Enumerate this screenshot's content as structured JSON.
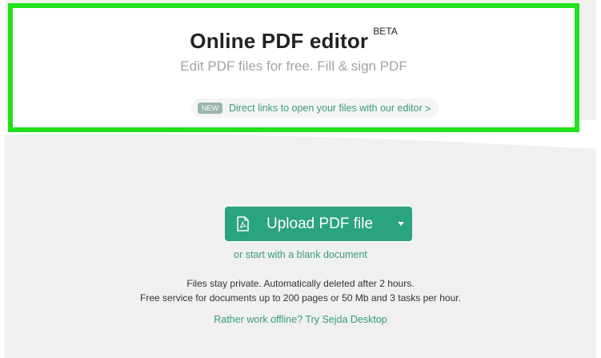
{
  "header": {
    "title": "Online PDF editor",
    "beta_badge": "BETA",
    "subtitle": "Edit PDF files for free. Fill & sign PDF",
    "news": {
      "badge": "NEW",
      "link_text": "Direct links to open your files with our editor",
      "chevron": ">"
    }
  },
  "main": {
    "upload_button_label": "Upload PDF file",
    "upload_icon": "pdf-file-icon",
    "dropdown_icon": "caret-down-icon",
    "blank_document_link": "or start with a blank document",
    "info_line_1": "Files stay private. Automatically deleted after 2 hours.",
    "info_line_2": "Free service for documents up to 200 pages or 50 Mb and 3 tasks per hour.",
    "offline_link": "Rather work offline? Try Sejda Desktop"
  },
  "colors": {
    "highlight_border": "#22e11a",
    "accent_green": "#2aa37f",
    "link_green": "#3a9a80",
    "background": "#f0f0f0"
  }
}
